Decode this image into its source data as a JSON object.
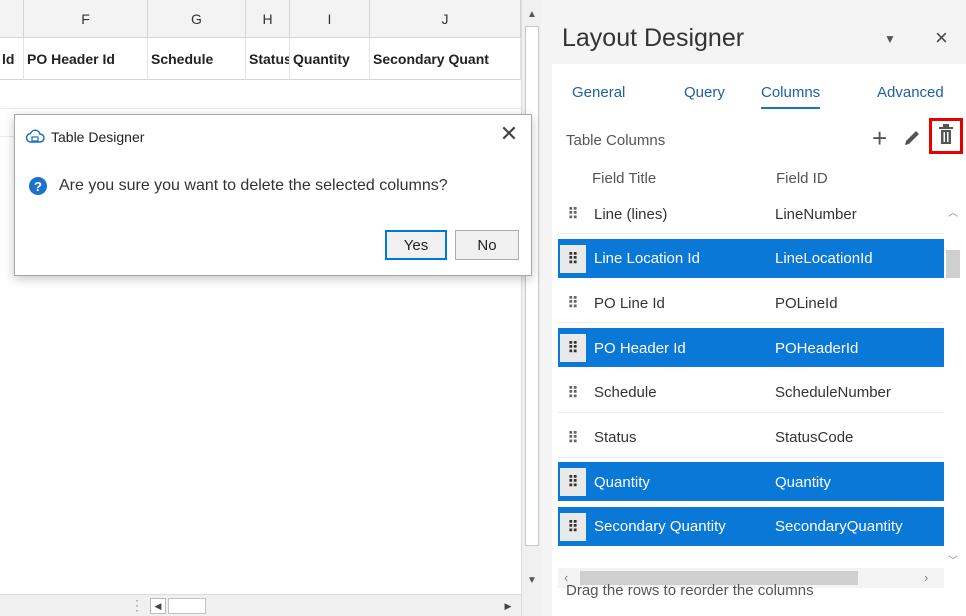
{
  "sheet": {
    "column_letters": [
      {
        "label": "",
        "name": "col-letter-e"
      },
      {
        "label": "F",
        "name": "col-letter-f"
      },
      {
        "label": "G",
        "name": "col-letter-g"
      },
      {
        "label": "H",
        "name": "col-letter-h"
      },
      {
        "label": "I",
        "name": "col-letter-i"
      },
      {
        "label": "J",
        "name": "col-letter-j"
      }
    ],
    "header_cells": [
      "ld",
      "PO Header Id",
      "Schedule",
      "Status",
      "Quantity",
      "Secondary Quant"
    ]
  },
  "dialog": {
    "title": "Table Designer",
    "close_glyph": "✕",
    "message": "Are you sure you want to delete the selected columns?",
    "yes_label": "Yes",
    "no_label": "No",
    "question_icon_glyph": "?"
  },
  "pane": {
    "title": "Layout Designer",
    "dropdown_glyph": "▼",
    "close_glyph": "×",
    "tabs": [
      "General",
      "Query",
      "Columns",
      "Advanced"
    ],
    "active_tab": "Columns",
    "section_label": "Table Columns",
    "add_glyph": "+",
    "col_field_title": "Field Title",
    "col_field_id": "Field ID",
    "rows": [
      {
        "title": "Line (lines)",
        "id": "LineNumber",
        "selected": false
      },
      {
        "title": "Line Location Id",
        "id": "LineLocationId",
        "selected": true
      },
      {
        "title": "PO Line Id",
        "id": "POLineId",
        "selected": false
      },
      {
        "title": "PO Header Id",
        "id": "POHeaderId",
        "selected": true
      },
      {
        "title": "Schedule",
        "id": "ScheduleNumber",
        "selected": false
      },
      {
        "title": "Status",
        "id": "StatusCode",
        "selected": false
      },
      {
        "title": "Quantity",
        "id": "Quantity",
        "selected": true
      },
      {
        "title": "Secondary Quantity",
        "id": "SecondaryQuantity",
        "selected": true
      }
    ],
    "hint": "Drag the rows to reorder the columns",
    "highlight_color": "#e60000",
    "selection_color": "#0a78d7"
  }
}
